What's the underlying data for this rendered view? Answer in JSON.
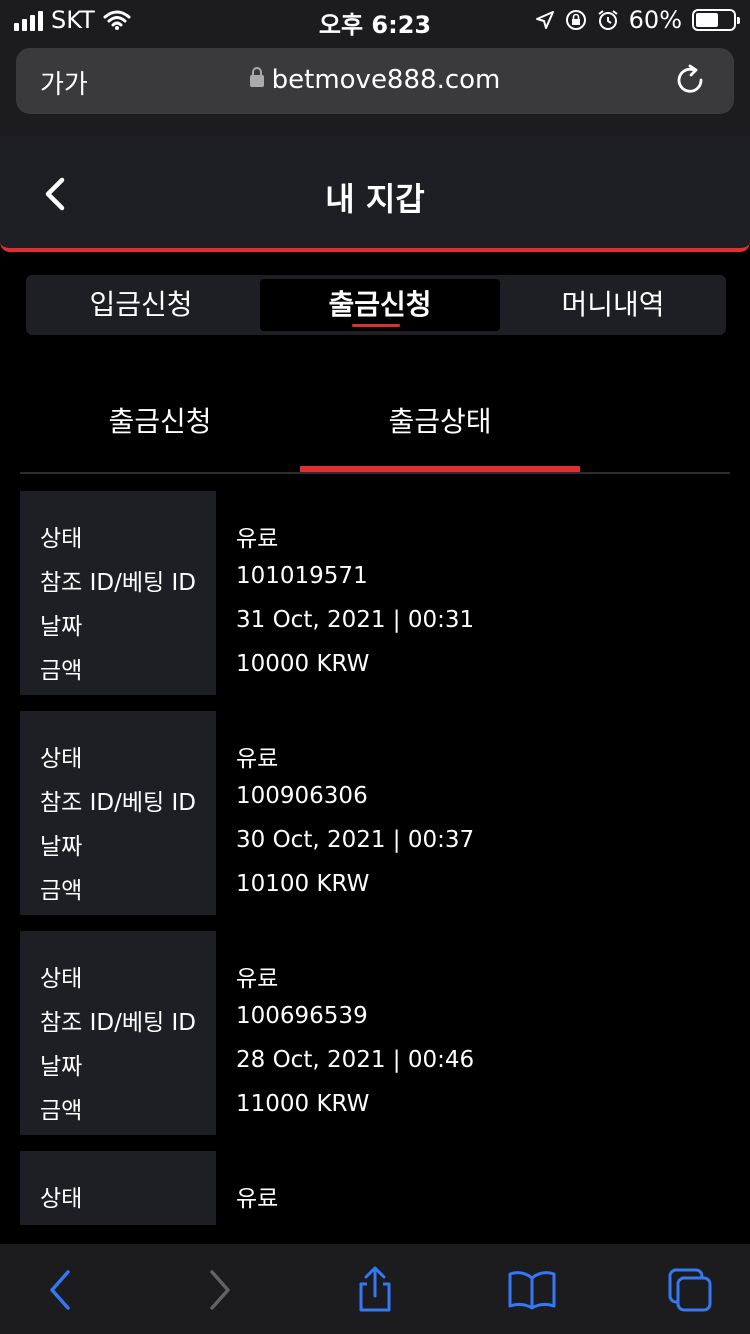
{
  "status_bar": {
    "carrier": "SKT",
    "time": "오후 6:23",
    "battery": "60%",
    "battery_level": 0.6
  },
  "browser": {
    "text_size_label": "가가",
    "url": "betmove888.com"
  },
  "header": {
    "title": "내 지갑"
  },
  "main_tabs": [
    {
      "label": "입금신청",
      "active": false
    },
    {
      "label": "출금신청",
      "active": true
    },
    {
      "label": "머니내역",
      "active": false
    }
  ],
  "sub_tabs": [
    {
      "label": "출금신청",
      "active": false
    },
    {
      "label": "출금상태",
      "active": true
    }
  ],
  "labels": {
    "status": "상태",
    "ref_id": "참조 ID/베팅 ID",
    "date": "날짜",
    "amount": "금액"
  },
  "records": [
    {
      "status": "유료",
      "ref_id": "101019571",
      "date": "31 Oct, 2021 | 00:31",
      "amount": "10000 KRW"
    },
    {
      "status": "유료",
      "ref_id": "100906306",
      "date": "30 Oct, 2021 | 00:37",
      "amount": "10100 KRW"
    },
    {
      "status": "유료",
      "ref_id": "100696539",
      "date": "28 Oct, 2021 | 00:46",
      "amount": "11000 KRW"
    },
    {
      "status": "유료"
    }
  ],
  "colors": {
    "accent": "#e0302d",
    "panel": "#1e1f24",
    "toolbar_icon": "#3478f6"
  },
  "icons": {
    "back": "chevron-left-icon",
    "forward": "chevron-right-icon",
    "share": "share-icon",
    "bookmarks": "book-icon",
    "tabs": "tabs-icon",
    "reload": "reload-icon"
  }
}
